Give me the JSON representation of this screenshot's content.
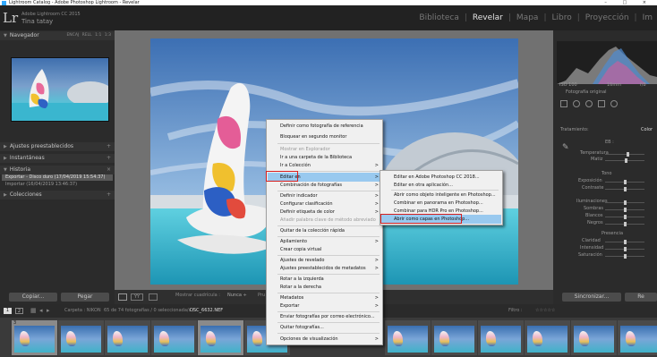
{
  "window": {
    "title": "Lightroom Catalog - Adobe Photoshop Lightroom - Revelar",
    "controls": "–  □  ×"
  },
  "header": {
    "logo": "Lr",
    "product": "Adobe Lightroom CC 2015",
    "user": "Tina tatay",
    "modules": [
      "Biblioteca",
      "Revelar",
      "Mapa",
      "Libro",
      "Proyección",
      "Im"
    ],
    "active_module": "Revelar",
    "separator": "|"
  },
  "left": {
    "navigator": {
      "title": "Navegador",
      "options": "ENCAJ  RELL  1:1  1:3"
    },
    "presets": {
      "title": "Ajustes preestablecidos",
      "plus": "+"
    },
    "snapshots": {
      "title": "Instantáneas",
      "plus": "+"
    },
    "history": {
      "title": "Historia",
      "close": "×",
      "rows": [
        "Exportar - Disco duro (17/04/2019 15:54:37)",
        "Importar (16/04/2019 13:46:37)"
      ]
    },
    "collections": {
      "title": "Colecciones",
      "plus": "+"
    },
    "copy_button": "Copiar...",
    "paste_button": "Pegar"
  },
  "toolbar": {
    "zoom_label": "Mostrar cuadrícula :",
    "zoom_value": "Nunca ÷",
    "right_label": "Pru"
  },
  "right": {
    "photo_info": "Fotografía original",
    "iso": "ISO 100",
    "focal": "16mm",
    "aperture": "f/8",
    "treatment_label": "Tratamiento:",
    "color_label": "Color",
    "wb_label": "EB :",
    "temp": "Temperatura",
    "tint": "Matiz",
    "tone": "Tono",
    "exposure": "Exposición",
    "contrast": "Contraste",
    "highlights": "Iluminaciones",
    "shadows": "Sombras",
    "whites": "Blancos",
    "blacks": "Negros",
    "presence": "Presencia",
    "clarity": "Claridad",
    "vibrance": "Intensidad",
    "saturation": "Saturación",
    "sync_button": "Sincronizar...",
    "reset_button": "Re"
  },
  "filmstrip": {
    "nums": [
      "1",
      "2"
    ],
    "path": "Carpeta : NIKON",
    "count": "65 de 74 fotografías / 0 seleccionada/s /",
    "file": "DSC_6632.NEF",
    "filter": "Filtro :",
    "stars": "☆☆☆☆☆",
    "cell_number": "3"
  },
  "context_menu": {
    "items": [
      {
        "label": "Definir como fotografía de referencia",
        "disabled": false
      },
      {
        "label": "Bloquear en segundo monitor",
        "disabled": false
      },
      {
        "label": "Mostrar en Explorador",
        "disabled": true
      },
      {
        "label": "Ir a una carpeta de la Biblioteca",
        "disabled": false
      },
      {
        "label": "Ir a Colección",
        "disabled": false,
        "submenu": true
      },
      {
        "label": "Editar en",
        "disabled": false,
        "submenu": true,
        "highlighted": true
      },
      {
        "label": "Combinación de fotografías",
        "disabled": false,
        "submenu": true
      },
      {
        "label": "Definir indicador",
        "disabled": false,
        "submenu": true
      },
      {
        "label": "Configurar clasificación",
        "disabled": false,
        "submenu": true
      },
      {
        "label": "Definir etiqueta de color",
        "disabled": false,
        "submenu": true
      },
      {
        "label": "Añadir palabra clave de método abreviado",
        "disabled": true
      },
      {
        "label": "Quitar de la colección rápida",
        "disabled": false
      },
      {
        "label": "Apilamiento",
        "disabled": false,
        "submenu": true
      },
      {
        "label": "Crear copia virtual",
        "disabled": false
      },
      {
        "label": "Ajustes de revelado",
        "disabled": false,
        "submenu": true
      },
      {
        "label": "Ajustes preestablecidos de metadatos",
        "disabled": false,
        "submenu": true
      },
      {
        "label": "Rotar a la izquierda",
        "disabled": false
      },
      {
        "label": "Rotar a la derecha",
        "disabled": false
      },
      {
        "label": "Metadatos",
        "disabled": false,
        "submenu": true
      },
      {
        "label": "Exportar",
        "disabled": false,
        "submenu": true
      },
      {
        "label": "Enviar fotografías por correo electrónico...",
        "disabled": false
      },
      {
        "label": "Quitar fotografías...",
        "disabled": false
      },
      {
        "label": "Opciones de visualización",
        "disabled": false,
        "submenu": true
      }
    ],
    "arrow": ">"
  },
  "submenu": {
    "items": [
      {
        "label": "Editar en Adobe Photoshop CC 2018...",
        "highlighted": false
      },
      {
        "label": "Editar en otra aplicación...",
        "highlighted": false
      },
      {
        "label": "Abrir como objeto inteligente en Photoshop...",
        "highlighted": false
      },
      {
        "label": "Combinar en panorama en Photoshop...",
        "highlighted": false
      },
      {
        "label": "Combinar para HDR Pro en Photoshop...",
        "highlighted": false
      },
      {
        "label": "Abrir como capas en Photoshop...",
        "highlighted": true
      }
    ]
  },
  "colors": {
    "highlight": "#99c9ef",
    "red_outline": "#d52020",
    "active_module": "#e2e2e2"
  }
}
